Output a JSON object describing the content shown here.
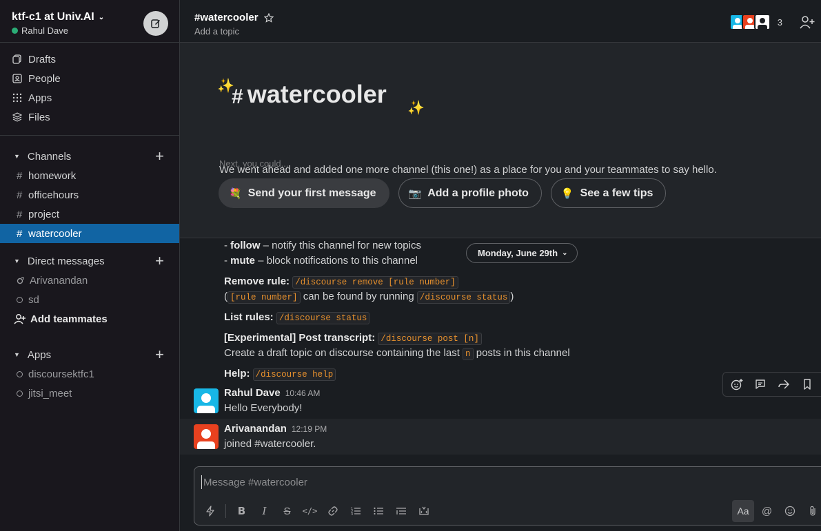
{
  "workspace": {
    "name": "ktf-c1 at Univ.AI",
    "user": "Rahul Dave",
    "presence_color": "#2bac76"
  },
  "nav": [
    {
      "label": "Drafts",
      "icon": "drafts-icon"
    },
    {
      "label": "People",
      "icon": "people-icon"
    },
    {
      "label": "Apps",
      "icon": "apps-grid-icon"
    },
    {
      "label": "Files",
      "icon": "files-layers-icon"
    }
  ],
  "channels": {
    "header": "Channels",
    "items": [
      "homework",
      "officehours",
      "project",
      "watercooler"
    ],
    "active": "watercooler"
  },
  "dms": {
    "header": "Direct messages",
    "items": [
      "Arivanandan",
      "sd"
    ],
    "add_label": "Add teammates"
  },
  "apps": {
    "header": "Apps",
    "items": [
      "discoursektfc1",
      "jitsi_meet"
    ]
  },
  "channel_header": {
    "title": "#watercooler",
    "topic": "Add a topic",
    "member_count": "3"
  },
  "intro": {
    "hash": "#",
    "title": "watercooler",
    "description": "We went ahead and added one more channel (this one!) as a place for you and your teammates to say hello.",
    "next_label": "Next, you could...",
    "actions": [
      {
        "emoji": "💐",
        "label": "Send your first message"
      },
      {
        "emoji": "📷",
        "label": "Add a profile photo"
      },
      {
        "emoji": "💡",
        "label": "See a few tips"
      }
    ]
  },
  "date_divider": "Monday, June 29th",
  "help_text": {
    "follow_cmd": "follow",
    "follow_desc": " – notify this channel for new topics",
    "mute_cmd": "mute",
    "mute_desc": " – block notifications to this channel",
    "remove_label": "Remove rule:",
    "remove_code": "/discourse remove [rule number]",
    "rule_number_code": "[rule number]",
    "rule_found_text": " can be found by running ",
    "status_code": "/discourse status",
    "list_label": "List rules:",
    "list_code": "/discourse status",
    "post_label": "[Experimental] Post transcript:",
    "post_code": "/discourse post [n]",
    "post_desc_before": "Create a draft topic on discourse containing the last ",
    "post_n": "n",
    "post_desc_after": " posts in this channel",
    "help_label": "Help:",
    "help_code": "/discourse help"
  },
  "messages": [
    {
      "author": "Rahul Dave",
      "time": "10:46 AM",
      "text": "Hello Everybody!",
      "avatar_color": "#18b7e6"
    },
    {
      "author": "Arivanandan",
      "time": "12:19 PM",
      "text": "joined #watercooler.",
      "avatar_color": "#e8411f"
    }
  ],
  "composer": {
    "placeholder": "Message #watercooler",
    "format_label": "Aa"
  },
  "colors": {
    "accent": "#1164a3",
    "code": "#e8912d"
  }
}
